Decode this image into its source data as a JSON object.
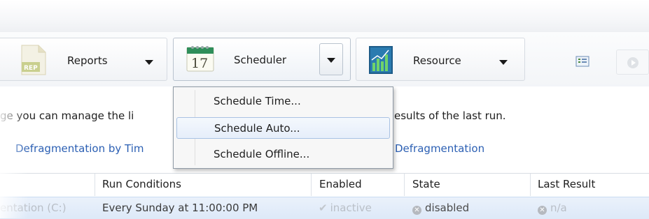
{
  "ribbon": {
    "reports": {
      "label": "Reports",
      "icon": "report-icon"
    },
    "scheduler": {
      "label": "Scheduler",
      "icon": "calendar-icon",
      "calendar_day": "17"
    },
    "resource": {
      "label": "Resource",
      "icon": "chart-icon"
    }
  },
  "menu": {
    "items": [
      {
        "label": "Schedule Time..."
      },
      {
        "label": "Schedule Auto..."
      },
      {
        "label": "Schedule Offline..."
      }
    ],
    "highlighted_index": 1
  },
  "description": {
    "left": "ge you can manage the li",
    "right": "esults of the last run."
  },
  "links": {
    "left": "Defragmentation by Tim",
    "right": "Defragmentation"
  },
  "table": {
    "columns": [
      "Run Conditions",
      "Enabled",
      "State",
      "Last Result"
    ],
    "row": {
      "name": "entation (C:)",
      "run_conditions": "Every Sunday at 11:00:00 PM",
      "enabled": "inactive",
      "state": "disabled",
      "last_result": "n/a"
    }
  },
  "colors": {
    "link": "#2b5fb3",
    "selection": "#dde9f8",
    "menu_border": "#8f9aa6"
  }
}
